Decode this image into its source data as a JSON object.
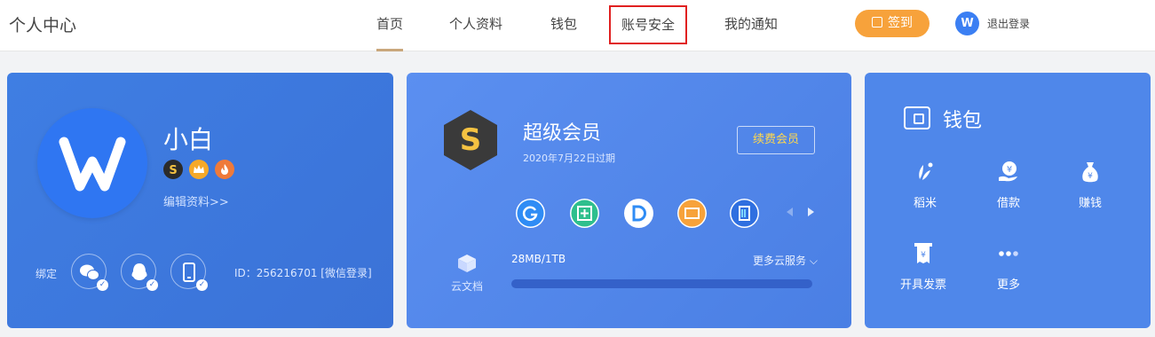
{
  "header": {
    "brand": "个人中心",
    "nav": [
      {
        "label": "首页",
        "active": true
      },
      {
        "label": "个人资料"
      },
      {
        "label": "钱包"
      },
      {
        "label": "账号安全",
        "highlighted": true
      },
      {
        "label": "我的通知"
      }
    ],
    "signin_label": "签到",
    "logout_label": "退出登录",
    "logout_icon": "wps-logo-icon"
  },
  "profile": {
    "username": "小白",
    "edit_link": "编辑资料>>",
    "bind_label": "绑定",
    "bind_icons": [
      "wechat-icon",
      "qq-icon",
      "phone-icon"
    ],
    "user_id": "ID：256216701 [微信登录]"
  },
  "vip": {
    "title": "超级会员",
    "expire": "2020年7月22日过期",
    "renew_label": "续费会员",
    "cloud_doc_label": "云文档",
    "storage_text": "28MB/1TB",
    "storage_fraction": 0.0,
    "more_services": "更多云服务",
    "apps": [
      {
        "name": "g-app-icon",
        "color": "#2f8cf5"
      },
      {
        "name": "plus-app-icon",
        "color": "#2fbf8d"
      },
      {
        "name": "d-app-icon",
        "color": "#2f8cf5"
      },
      {
        "name": "screen-app-icon",
        "color": "#f7a23b"
      },
      {
        "name": "doc-app-icon",
        "color": "#2f6fe0"
      }
    ]
  },
  "wallet": {
    "title": "钱包",
    "items": [
      {
        "label": "稻米",
        "icon": "rice-icon"
      },
      {
        "label": "借款",
        "icon": "loan-icon"
      },
      {
        "label": "赚钱",
        "icon": "money-bag-icon"
      },
      {
        "label": "开具发票",
        "icon": "invoice-icon"
      },
      {
        "label": "更多",
        "icon": "more-icon"
      }
    ]
  },
  "colors": {
    "accent": "#f7a23b",
    "primary": "#3b7ff3",
    "highlight_border": "#e02020"
  }
}
